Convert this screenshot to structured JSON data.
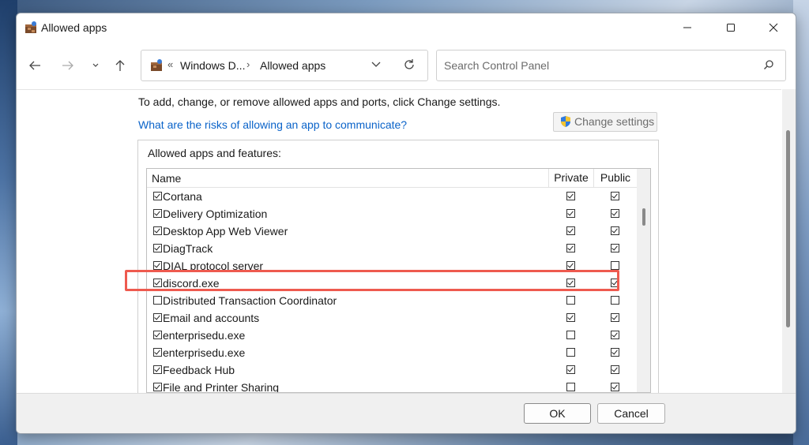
{
  "window": {
    "title": "Allowed apps"
  },
  "address": {
    "crumbs": [
      "Windows D...",
      "Allowed apps"
    ],
    "prefix": "«"
  },
  "search": {
    "placeholder": "Search Control Panel"
  },
  "content": {
    "instruction": "To add, change, or remove allowed apps and ports, click Change settings.",
    "risk_link": "What are the risks of allowing an app to communicate?",
    "change_settings": "Change settings",
    "group_label": "Allowed apps and features:",
    "columns": {
      "name": "Name",
      "private": "Private",
      "public": "Public"
    },
    "rows": [
      {
        "name": "Cortana",
        "enabled": true,
        "private": true,
        "public": true
      },
      {
        "name": "Delivery Optimization",
        "enabled": true,
        "private": true,
        "public": true
      },
      {
        "name": "Desktop App Web Viewer",
        "enabled": true,
        "private": true,
        "public": true
      },
      {
        "name": "DiagTrack",
        "enabled": true,
        "private": true,
        "public": true
      },
      {
        "name": "DIAL protocol server",
        "enabled": true,
        "private": true,
        "public": false
      },
      {
        "name": "discord.exe",
        "enabled": true,
        "private": true,
        "public": true
      },
      {
        "name": "Distributed Transaction Coordinator",
        "enabled": false,
        "private": false,
        "public": false
      },
      {
        "name": "Email and accounts",
        "enabled": true,
        "private": true,
        "public": true
      },
      {
        "name": "enterprisedu.exe",
        "enabled": true,
        "private": false,
        "public": true
      },
      {
        "name": "enterprisedu.exe",
        "enabled": true,
        "private": false,
        "public": true
      },
      {
        "name": "Feedback Hub",
        "enabled": true,
        "private": true,
        "public": true
      },
      {
        "name": "File and Printer Sharing",
        "enabled": true,
        "private": false,
        "public": true
      }
    ],
    "highlighted_row": "discord.exe"
  },
  "footer": {
    "ok": "OK",
    "cancel": "Cancel"
  },
  "colors": {
    "link": "#0a63c9",
    "highlight": "#ee5a4f"
  }
}
